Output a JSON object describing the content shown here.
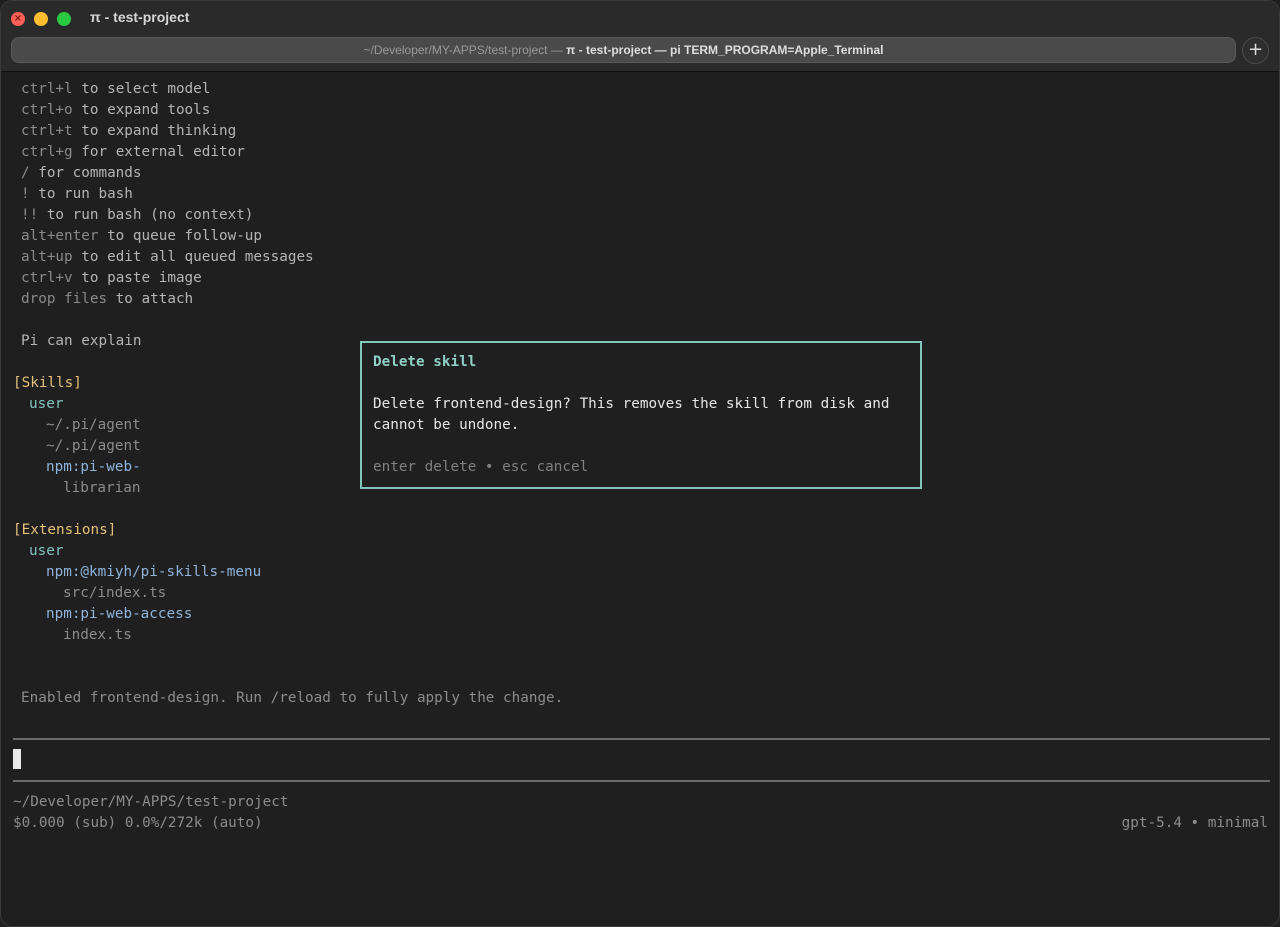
{
  "window": {
    "title": "π - test-project",
    "tab_title_path": "~/Developer/MY-APPS/test-project —",
    "tab_title_main": "π - test-project — pi TERM_PROGRAM=Apple_Terminal",
    "new_tab_glyph": "+"
  },
  "shortcuts": [
    {
      "key": "ctrl+l",
      "desc": " to select model"
    },
    {
      "key": "ctrl+o",
      "desc": " to expand tools"
    },
    {
      "key": "ctrl+t",
      "desc": " to expand thinking"
    },
    {
      "key": "ctrl+g",
      "desc": " for external editor"
    },
    {
      "key": "/",
      "desc": " for commands"
    },
    {
      "key": "!",
      "desc": " to run bash"
    },
    {
      "key": "!!",
      "desc": " to run bash (no context)"
    },
    {
      "key": "alt+enter",
      "desc": " to queue follow-up"
    },
    {
      "key": "alt+up",
      "desc": " to edit all queued messages"
    },
    {
      "key": "ctrl+v",
      "desc": " to paste image"
    },
    {
      "key": "drop files",
      "desc": " to attach"
    }
  ],
  "explain_line": "Pi can explain",
  "skills": {
    "header": "[Skills]",
    "scope": "user",
    "items": [
      "~/.pi/agent",
      "~/.pi/agent"
    ],
    "package": "npm:pi-web-",
    "package_cont": "librarian"
  },
  "extensions": {
    "header": "[Extensions]",
    "scope": "user",
    "items": [
      {
        "package": "npm:@kmiyh/pi-skills-menu",
        "file": "src/index.ts"
      },
      {
        "package": "npm:pi-web-access",
        "file": "index.ts"
      }
    ]
  },
  "status_message": "Enabled frontend-design. Run /reload to fully apply the change.",
  "footer": {
    "cwd": "~/Developer/MY-APPS/test-project",
    "usage": "$0.000 (sub) 0.0%/272k (auto)",
    "model": "gpt-5.4 • minimal"
  },
  "dialog": {
    "title": "Delete skill",
    "body": "Delete frontend-design? This removes the skill from disk and cannot be undone.",
    "hint_enter_key": "enter",
    "hint_enter_action": "delete",
    "hint_sep": "•",
    "hint_esc_key": "esc",
    "hint_esc_action": "cancel"
  },
  "colors": {
    "section": "#e5c07b",
    "scope": "#82c4c0",
    "package": "#8fb3d9",
    "dialog_border": "#7fc7bb"
  }
}
